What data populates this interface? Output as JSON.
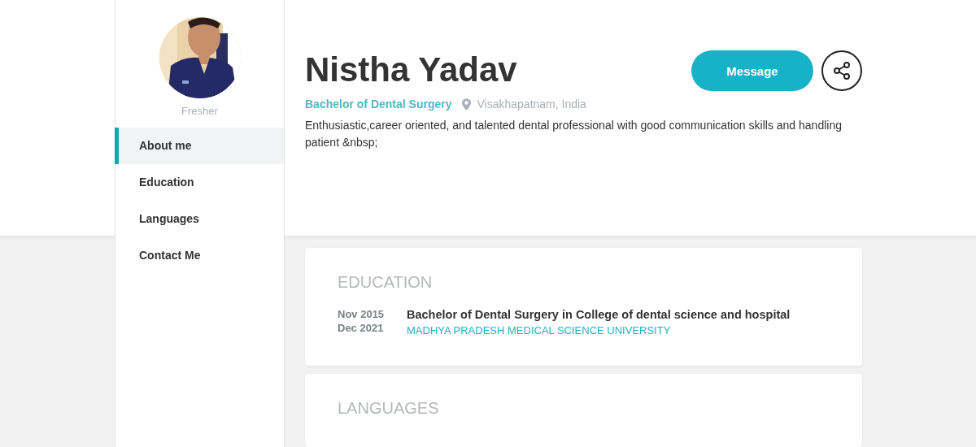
{
  "profile": {
    "status": "Fresher",
    "name": "Nistha Yadav",
    "degree": "Bachelor of Dental Surgery",
    "location": "Visakhapatnam, India",
    "bio": "Enthusiastic,career oriented, and talented dental professional with good communication skills and handling patient &nbsp;",
    "message_button": "Message"
  },
  "sidebar": {
    "items": [
      {
        "label": "About me",
        "selected": true
      },
      {
        "label": "Education",
        "selected": false
      },
      {
        "label": "Languages",
        "selected": false
      },
      {
        "label": "Contact Me",
        "selected": false
      }
    ]
  },
  "sections": [
    {
      "title": "EDUCATION",
      "entries": [
        {
          "start": "Nov 2015",
          "end": "Dec 2021",
          "title": "Bachelor of Dental Surgery in College of dental science and hospital",
          "institution": "MADHYA PRADESH MEDICAL SCIENCE UNIVERSITY"
        }
      ]
    },
    {
      "title": "LANGUAGES"
    }
  ]
}
